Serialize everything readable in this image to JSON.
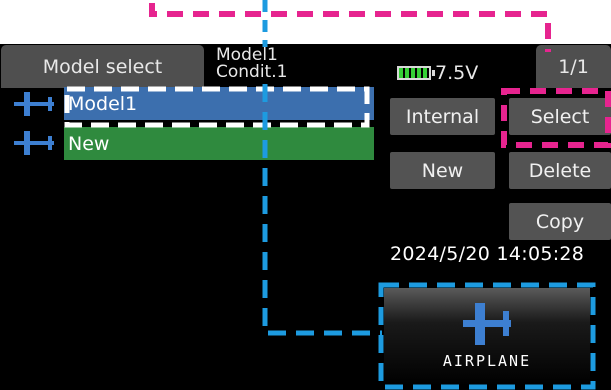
{
  "header": {
    "title": "Model select",
    "model_name": "Model1",
    "condition": "Condit.1",
    "voltage": "7.5V",
    "page": "1/1"
  },
  "models": [
    {
      "label": "Model1",
      "selected": true
    },
    {
      "label": "New",
      "selected": false
    }
  ],
  "buttons": {
    "internal": "Internal",
    "select": "Select",
    "new": "New",
    "delete": "Delete",
    "copy": "Copy"
  },
  "datetime": "2024/5/20 14:05:28",
  "model_type": {
    "label": "AIRPLANE",
    "icon": "airplane-icon"
  },
  "colors": {
    "selected_row": "#3c6fae",
    "new_row": "#2f8a3e",
    "button": "#535353",
    "callout_pink": "#e6248f",
    "callout_blue": "#1d9be0"
  }
}
